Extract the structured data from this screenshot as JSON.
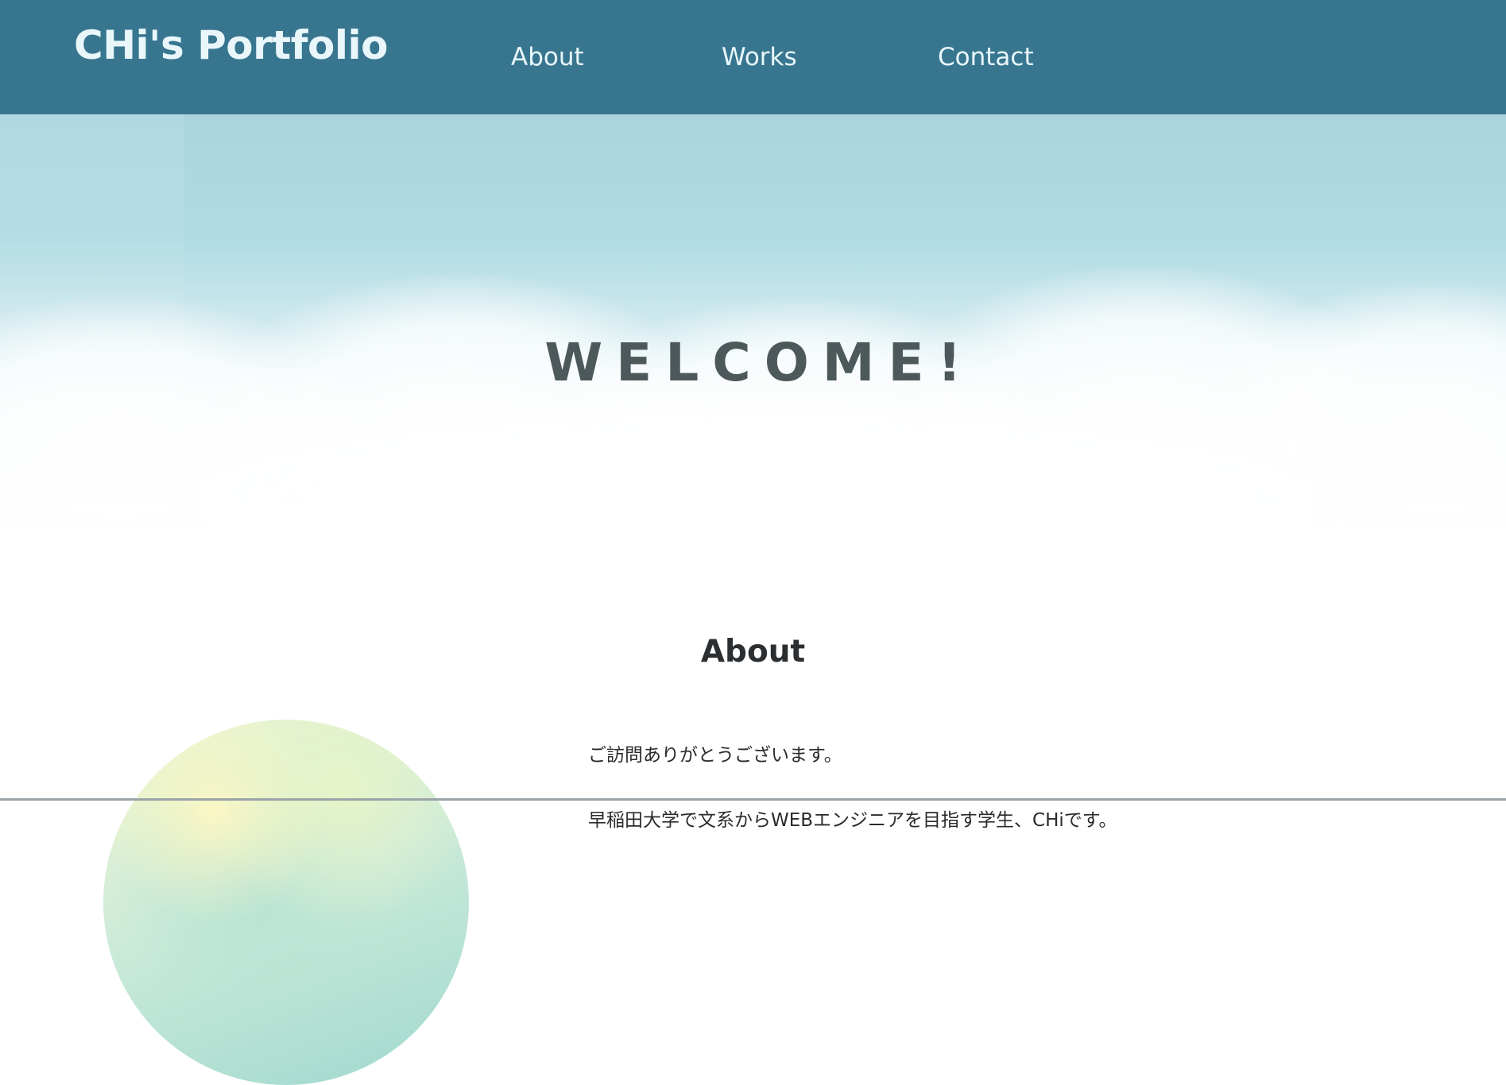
{
  "header": {
    "brand": "CHi's Portfolio",
    "nav": {
      "about": "About",
      "works": "Works",
      "contact": "Contact"
    },
    "background_color": "#387690",
    "text_color": "#e9f7fb"
  },
  "hero": {
    "title": "WELCOME!",
    "title_color": "#4d585b",
    "sky_color": "#afdbe3"
  },
  "about": {
    "heading": "About",
    "paragraphs": [
      "ご訪問ありがとうございます。",
      "早稲田大学で文系からWEBエンジニアを目指す学生、CHiです。"
    ]
  }
}
